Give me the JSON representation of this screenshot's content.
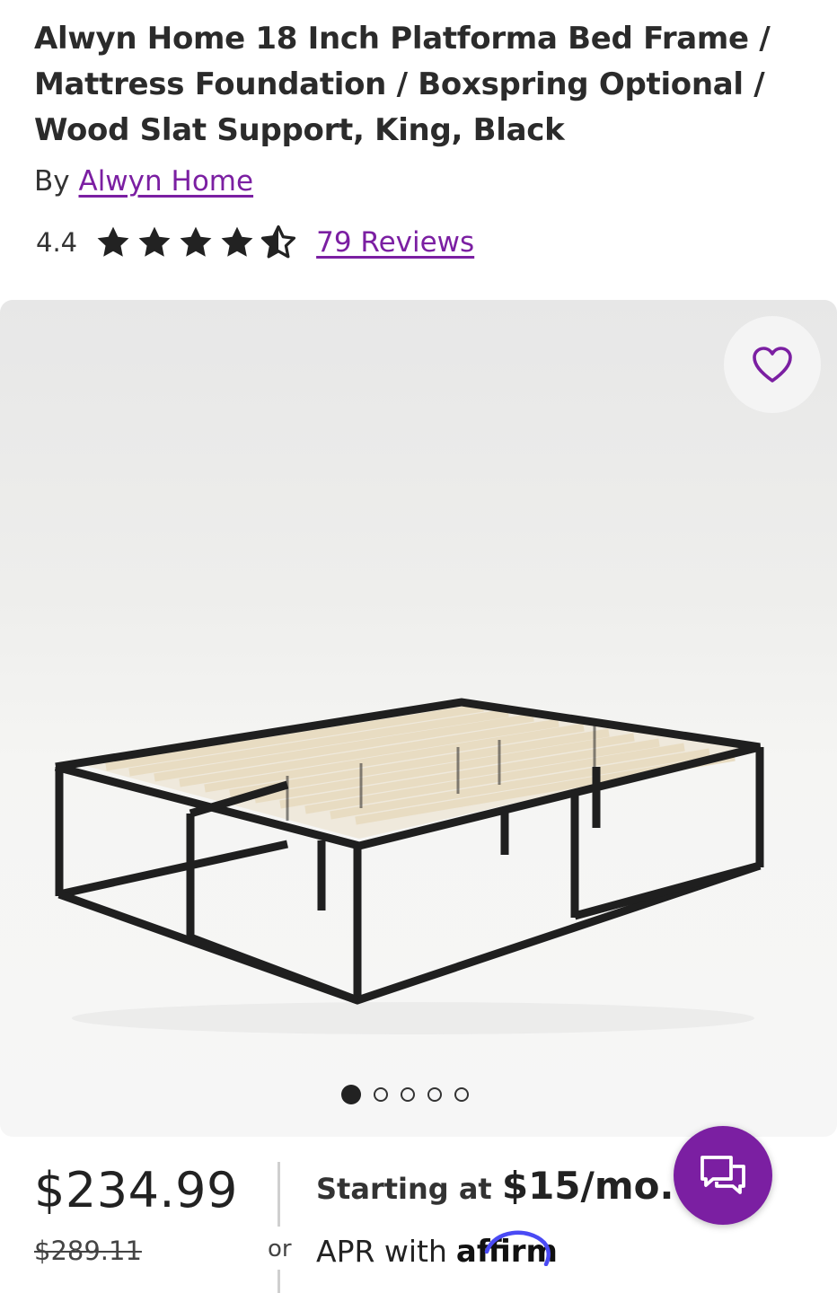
{
  "product": {
    "title": "Alwyn Home 18 Inch Platforma Bed Frame / Mattress Foundation / Boxspring Optional / Wood Slat Support, King, Black",
    "by_prefix": "By",
    "brand": "Alwyn Home",
    "rating": "4.4",
    "stars_rating": 4.4,
    "reviews_label": "79 Reviews"
  },
  "gallery": {
    "image_count": 5,
    "active_index": 0,
    "favorite_icon": "heart-outline-icon"
  },
  "pricing": {
    "price": "$234.99",
    "was_price": "$289.11",
    "or_label": "or",
    "financing_prefix": "Starting at",
    "financing_amount": "$15/mo.",
    "financing_cut": "o",
    "apr_text": "APR with",
    "affirm_label": "affirm"
  },
  "colors": {
    "brand_purple": "#7b1fa2",
    "text": "#222222"
  },
  "chat": {
    "icon": "chat-bubbles-icon"
  }
}
